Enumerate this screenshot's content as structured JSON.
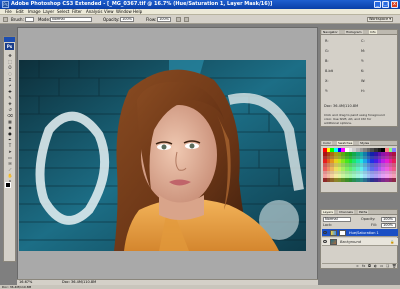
{
  "window": {
    "title": "Adobe Photoshop CS3 Extended - [_MG_0367.tif @ 16.7% (Hue/Saturation 1, Layer Mask/16)]",
    "minimize_label": "_",
    "maximize_label": "□",
    "close_label": "x"
  },
  "menu": [
    "File",
    "Edit",
    "Image",
    "Layer",
    "Select",
    "Filter",
    "Analysis",
    "View",
    "Window",
    "Help"
  ],
  "options_bar": {
    "brush_label": "Brush:",
    "brush_size": "",
    "mode_label": "Mode:",
    "mode_value": "Normal",
    "opacity_label": "Opacity:",
    "opacity_value": "100%",
    "flow_label": "Flow:",
    "flow_value": "100%",
    "workspace_label": "Workspace ▾"
  },
  "toolbox": {
    "badge": "Ps",
    "tools": [
      "move-tool",
      "marquee-tool",
      "lasso-tool",
      "quick-select-tool",
      "crop-tool",
      "slice-tool",
      "healing-tool",
      "brush-tool",
      "clone-stamp-tool",
      "history-brush-tool",
      "eraser-tool",
      "gradient-tool",
      "blur-tool",
      "dodge-tool",
      "pen-tool",
      "type-tool",
      "path-select-tool",
      "shape-tool",
      "notes-tool",
      "eyedropper-tool",
      "hand-tool",
      "zoom-tool"
    ],
    "tool_glyphs": [
      "✥",
      "⬚",
      "ʘ",
      "◌",
      "⌗",
      "⌿",
      "✚",
      "✎",
      "⎈",
      "↺",
      "⌫",
      "▦",
      "◆",
      "●",
      "✒",
      "T",
      "➤",
      "▭",
      "✉",
      "⟋",
      "✋",
      "⚲"
    ]
  },
  "document": {
    "zoom": "16.67%",
    "doc_info": "Doc: 36.4M/110.8M"
  },
  "info_panel": {
    "tabs": [
      "Navigator",
      "Histogram",
      "Info"
    ],
    "rows": [
      [
        "R:",
        "",
        "C:",
        ""
      ],
      [
        "G:",
        "",
        "M:",
        ""
      ],
      [
        "B:",
        "",
        "Y:",
        ""
      ],
      [
        "8-bit",
        "",
        "K:",
        ""
      ],
      [
        "X:",
        "",
        "W:",
        ""
      ],
      [
        "Y:",
        "",
        "H:",
        ""
      ]
    ],
    "doc_line": "Doc: 36.4M/110.8M",
    "hint_1": "Click and drag to paint using foreground",
    "hint_2": "color. Use Shift, Alt, and Ctrl for",
    "hint_3": "additional options."
  },
  "swatches_panel": {
    "tabs": [
      "Color",
      "Swatches",
      "Styles"
    ]
  },
  "layers_panel": {
    "tabs": [
      "Layers",
      "Channels",
      "Paths"
    ],
    "blend_mode": "Normal",
    "opacity_label": "Opacity:",
    "opacity_value": "100%",
    "lock_label": "Lock:",
    "fill_label": "Fill:",
    "fill_value": "100%",
    "layers": [
      {
        "name": "Hue/Saturation 1",
        "selected": true
      },
      {
        "name": "Background",
        "selected": false
      }
    ],
    "icons": [
      "link-icon",
      "fx-icon",
      "mask-icon",
      "adjustment-icon",
      "folder-icon",
      "new-layer-icon",
      "trash-icon"
    ]
  },
  "colors": {
    "title_bar": "#0a3fa8",
    "chrome": "#d4d0c8",
    "workspace": "#7f7f7f",
    "selection": "#1a4fc4"
  }
}
